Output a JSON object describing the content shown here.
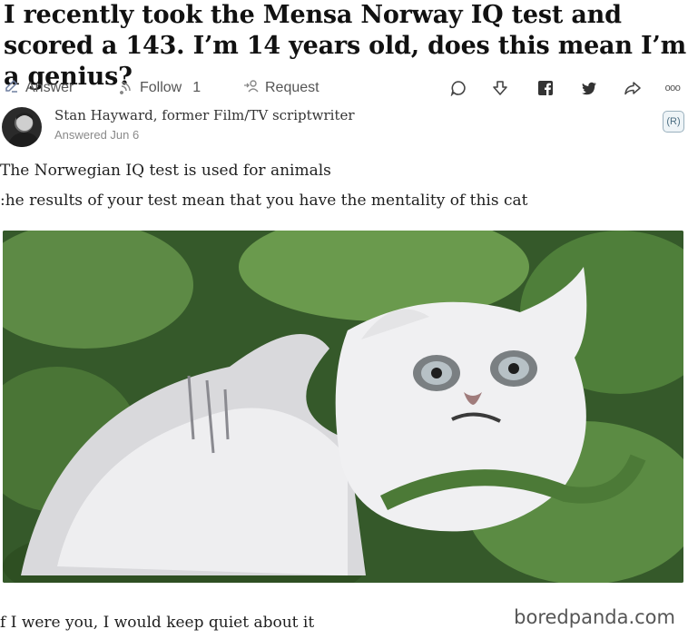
{
  "question": {
    "title": "I recently took the Mensa Norway IQ test and scored a 143. I’m 14 years old, does this mean I’m a genius?"
  },
  "actions": {
    "answer_label": "Answer",
    "follow_label": "Follow",
    "follow_count": "1",
    "request_label": "Request",
    "comment_icon": "comment-icon",
    "downvote_icon": "downvote-icon",
    "facebook_icon": "facebook-icon",
    "twitter_icon": "twitter-icon",
    "share_icon": "share-icon",
    "more_label": "ooo"
  },
  "answer": {
    "author": "Stan Hayward, former Film/TV scriptwriter",
    "answered": "Answered Jun 6",
    "line1": "The Norwegian IQ test is used for animals",
    "line2": ":he results of your test mean that you have the mentality of this cat",
    "line3": "f I were you, I would keep quiet about it"
  },
  "side_icon_label": "(R)",
  "watermark": "boredpanda.com",
  "colors": {
    "accent_icon": "#4c6e82",
    "foliage": "#3f6a2e",
    "cat": "#e8e8ea"
  }
}
